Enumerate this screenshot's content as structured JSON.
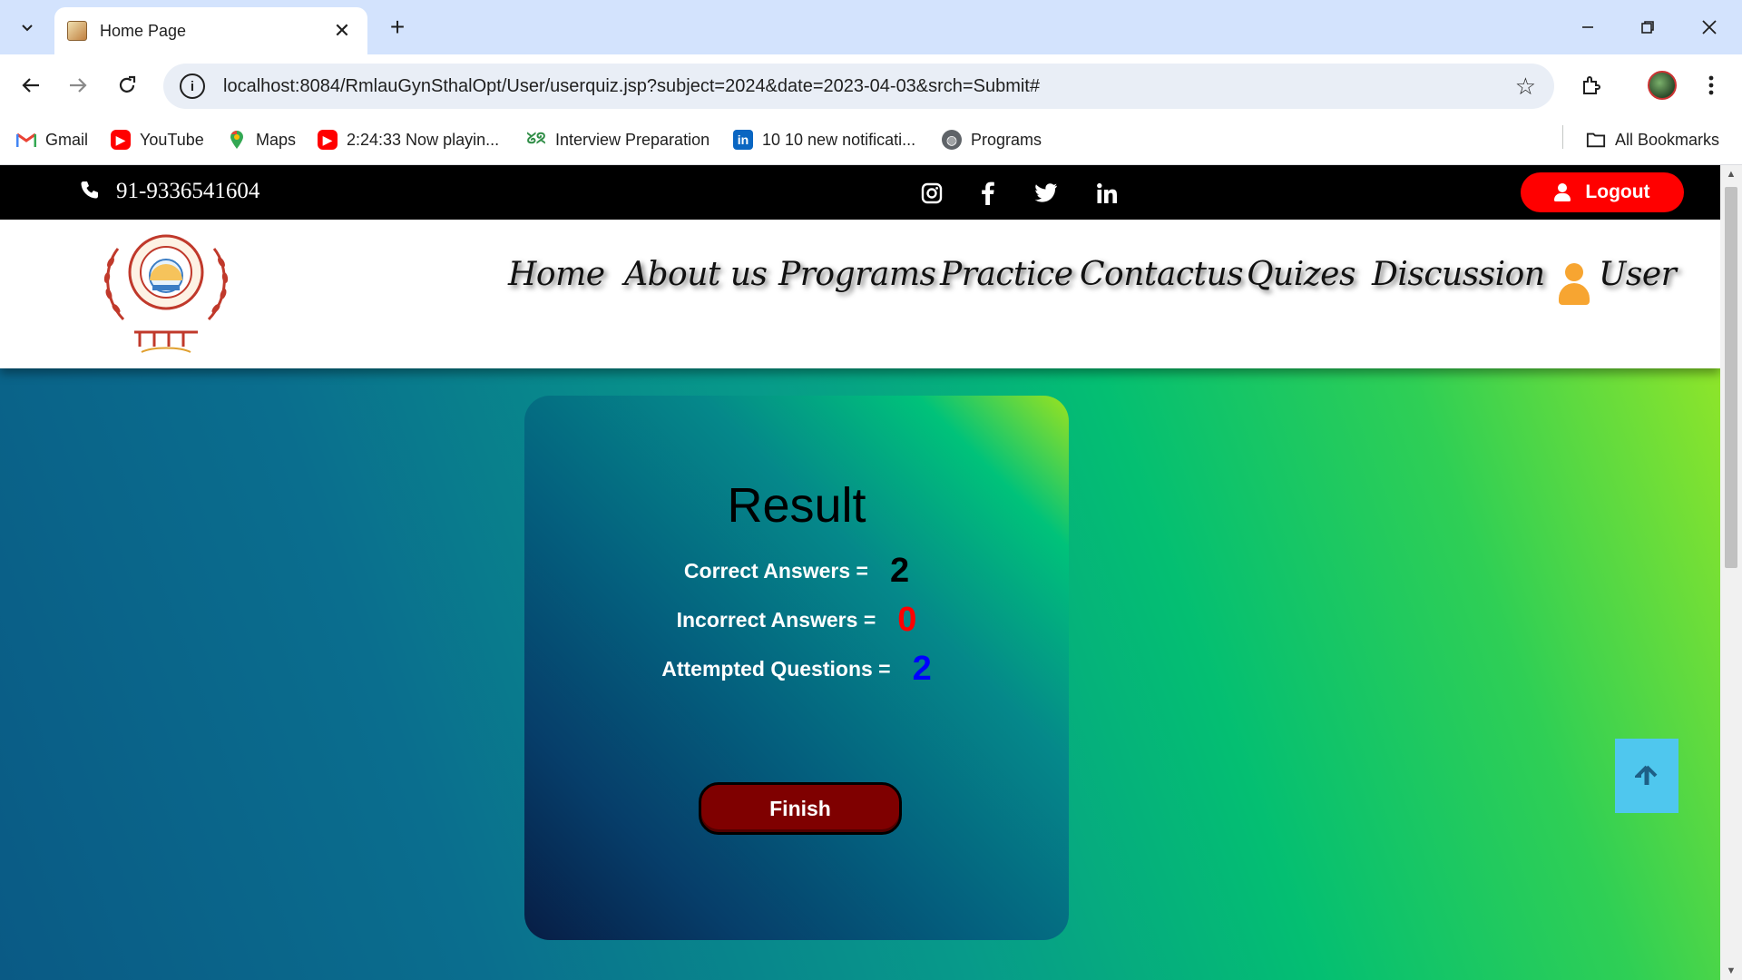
{
  "browser": {
    "tab_title": "Home Page",
    "new_tab_symbol": "+",
    "url": "localhost:8084/RmlauGynSthalOpt/User/userquiz.jsp?subject=2024&date=2023-04-03&srch=Submit#"
  },
  "bookmarks": {
    "items": [
      {
        "label": "Gmail",
        "icon": "gmail-icon"
      },
      {
        "label": "YouTube",
        "icon": "youtube-icon"
      },
      {
        "label": "Maps",
        "icon": "maps-icon"
      },
      {
        "label": "2:24:33 Now playin...",
        "icon": "youtube-icon"
      },
      {
        "label": "Interview Preparation",
        "icon": "geeksforgeeks-icon"
      },
      {
        "label": "10 10 new notificati...",
        "icon": "linkedin-icon"
      },
      {
        "label": "Programs",
        "icon": "globe-icon"
      }
    ],
    "all_bookmarks": "All Bookmarks"
  },
  "topbar": {
    "phone": "91-9336541604",
    "logout_label": "Logout",
    "social": [
      "instagram-icon",
      "facebook-icon",
      "twitter-icon",
      "linkedin-icon"
    ]
  },
  "nav": {
    "items": [
      "Home",
      "About us",
      "Programs",
      "Practice",
      "Contactus",
      "Quizes",
      "Discussion"
    ],
    "user_label": "User"
  },
  "result": {
    "title": "Result",
    "correct_label": "Correct Answers =",
    "correct_value": "2",
    "incorrect_label": "Incorrect Answers =",
    "incorrect_value": "0",
    "attempted_label": "Attempted Questions =",
    "attempted_value": "2",
    "finish_label": "Finish"
  },
  "colors": {
    "logout_bg": "#ff0000",
    "correct_value": "#000000",
    "incorrect_value": "#ff0000",
    "attempted_value": "#0000ff",
    "finish_bg": "#7f0000",
    "user_icon": "#f7a531",
    "to_top_bg": "#4fc7ee"
  }
}
